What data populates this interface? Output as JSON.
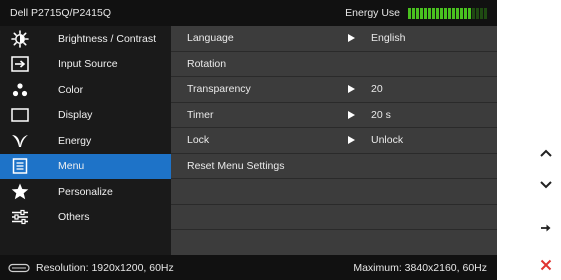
{
  "title": {
    "model": "Dell P2715Q/P2415Q",
    "energy_label": "Energy Use"
  },
  "energy_meter": {
    "lit_segments": 16,
    "total_segments": 20,
    "lit_color": "#49c11f",
    "dim_color": "#1f4a12"
  },
  "sidebar": {
    "items": [
      {
        "label": "Brightness / Contrast",
        "icon": "brightness-icon"
      },
      {
        "label": "Input Source",
        "icon": "input-source-icon"
      },
      {
        "label": "Color",
        "icon": "color-icon"
      },
      {
        "label": "Display",
        "icon": "display-icon"
      },
      {
        "label": "Energy",
        "icon": "energy-icon"
      },
      {
        "label": "Menu",
        "icon": "menu-icon",
        "active": true
      },
      {
        "label": "Personalize",
        "icon": "star-icon"
      },
      {
        "label": "Others",
        "icon": "others-icon"
      }
    ]
  },
  "menu_settings": {
    "rows": [
      {
        "label": "Language",
        "value": "English",
        "has_arrow": true
      },
      {
        "label": "Rotation",
        "value": "",
        "has_arrow": false
      },
      {
        "label": "Transparency",
        "value": "20",
        "has_arrow": true
      },
      {
        "label": "Timer",
        "value": "20 s",
        "has_arrow": true
      },
      {
        "label": "Lock",
        "value": "Unlock",
        "has_arrow": true
      },
      {
        "label": "Reset Menu Settings",
        "value": "",
        "has_arrow": false
      }
    ]
  },
  "status": {
    "resolution": "Resolution: 1920x1200, 60Hz",
    "maximum": "Maximum: 3840x2160, 60Hz"
  },
  "nav_keys": [
    {
      "name": "up-key",
      "icon": "chevron-up-icon"
    },
    {
      "name": "down-key",
      "icon": "chevron-down-icon"
    },
    {
      "name": "enter-key",
      "icon": "arrow-right-icon"
    },
    {
      "name": "exit-key",
      "icon": "close-icon"
    }
  ],
  "colors": {
    "accent": "#1e73c8",
    "exit": "#e0332f",
    "key": "#222222"
  }
}
